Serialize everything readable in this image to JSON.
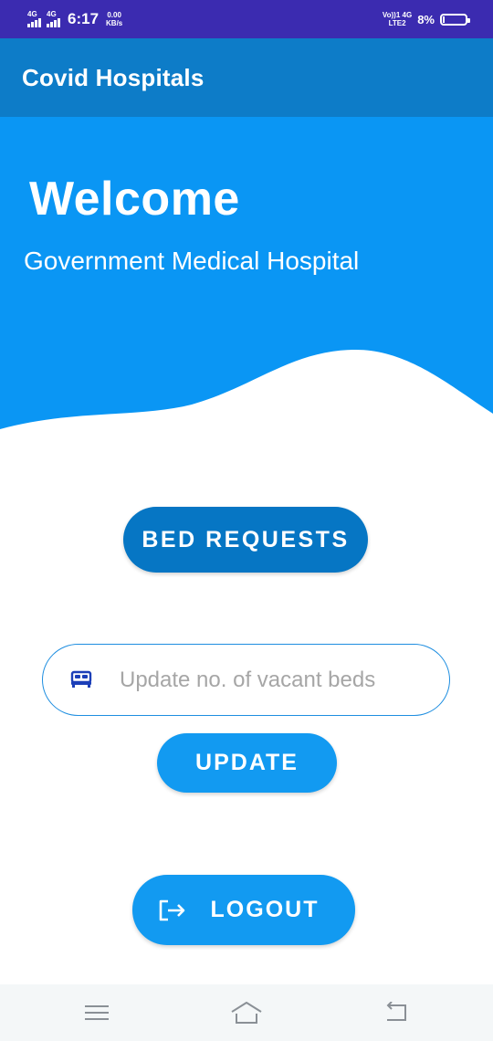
{
  "status_bar": {
    "network_1": "4G",
    "network_2": "4G",
    "time": "6:17",
    "speed_value": "0.00",
    "speed_unit": "KB/s",
    "volte_top": "Vo))1 4G",
    "volte_bottom": "LTE2",
    "battery_percent": "8%",
    "battery_level": 0.08,
    "battery_icon": "battery-icon"
  },
  "app_bar": {
    "title": "Covid Hospitals"
  },
  "hero": {
    "welcome": "Welcome",
    "hospital_name": "Government Medical Hospital",
    "color": "#0a96f4"
  },
  "actions": {
    "bed_requests_label": "BED REQUESTS",
    "vacant_beds_placeholder": "Update no. of vacant beds",
    "vacant_beds_value": "",
    "update_label": "UPDATE",
    "logout_label": "LOGOUT"
  },
  "icons": {
    "bed": "bed-icon",
    "logout": "logout-icon",
    "menu": "menu-icon",
    "home": "home-icon",
    "back": "back-icon"
  },
  "colors": {
    "status_bar": "#3b2bb0",
    "app_bar": "#0d7cc8",
    "primary_button": "#0676c4",
    "accent_button": "#129af1"
  }
}
